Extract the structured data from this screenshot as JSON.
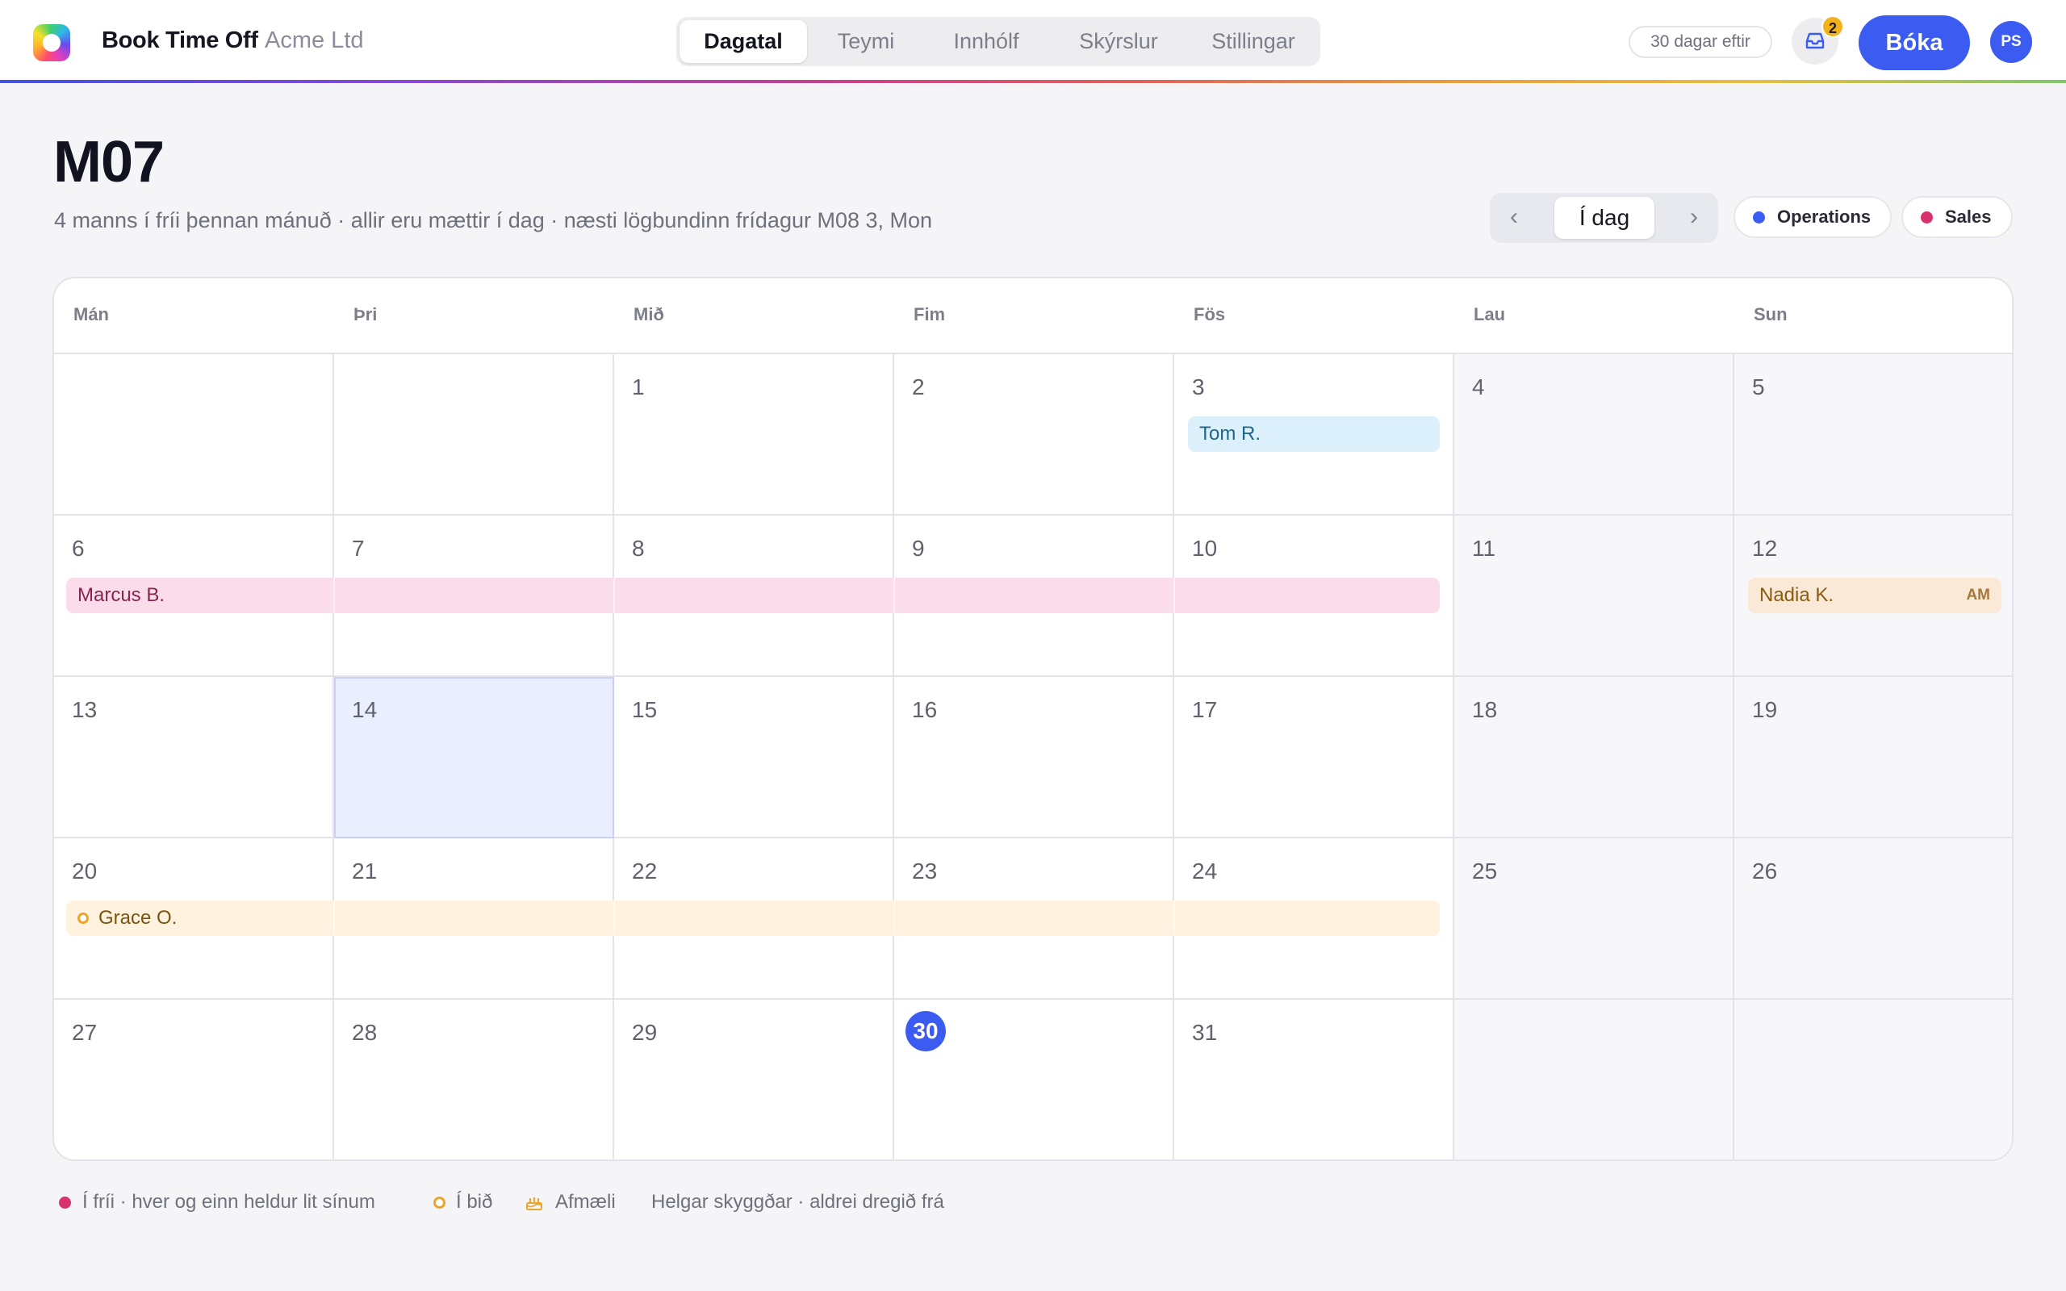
{
  "app": {
    "brand": "Book Time Off",
    "company": "Acme Ltd"
  },
  "nav": {
    "tabs": [
      "Dagatal",
      "Teymi",
      "Innhólf",
      "Skýrslur",
      "Stillingar"
    ],
    "active": "Dagatal"
  },
  "topbar": {
    "days_left": "30 dagar eftir",
    "inbox_count": "2",
    "book_label": "Bóka",
    "avatar_initials": "PS"
  },
  "header": {
    "title": "M07",
    "subtitle": "4 manns í fríi þennan mánuð · allir eru mættir í dag · næsti lögbundinn frídagur M08 3, Mon"
  },
  "pager": {
    "prev": "‹",
    "today": "Í dag",
    "next": "›"
  },
  "filters": [
    {
      "label": "Operations",
      "color": "#3c5bf0"
    },
    {
      "label": "Sales",
      "color": "#d6336c"
    }
  ],
  "calendar": {
    "weekdays": [
      "Mán",
      "Þri",
      "Mið",
      "Fim",
      "Fös",
      "Lau",
      "Sun"
    ],
    "weeks": [
      [
        "",
        "",
        "1",
        "2",
        "3",
        "4",
        "5"
      ],
      [
        "6",
        "7",
        "8",
        "9",
        "10",
        "11",
        "12"
      ],
      [
        "13",
        "14",
        "15",
        "16",
        "17",
        "18",
        "19"
      ],
      [
        "20",
        "21",
        "22",
        "23",
        "24",
        "25",
        "26"
      ],
      [
        "27",
        "28",
        "29",
        "30",
        "31",
        "",
        ""
      ]
    ],
    "today": "30",
    "events": [
      {
        "name": "Tom R.",
        "tag": ""
      },
      {
        "name": "Marcus B.",
        "tag": ""
      },
      {
        "name": "Nadia K.",
        "tag": "AM"
      },
      {
        "name": "Grace O.",
        "tag": ""
      }
    ]
  },
  "legend": {
    "off": "Í fríi · hver og einn heldur lit sínum",
    "pending": "Í bið",
    "birthday": "Afmæli",
    "weekends": "Helgar skyggðar · aldrei dregið frá"
  },
  "colors": {
    "accent": "#3c5bf0",
    "off_dot": "#d6336c",
    "pending": "#eaa52a",
    "birthday": "#eaa52a"
  }
}
